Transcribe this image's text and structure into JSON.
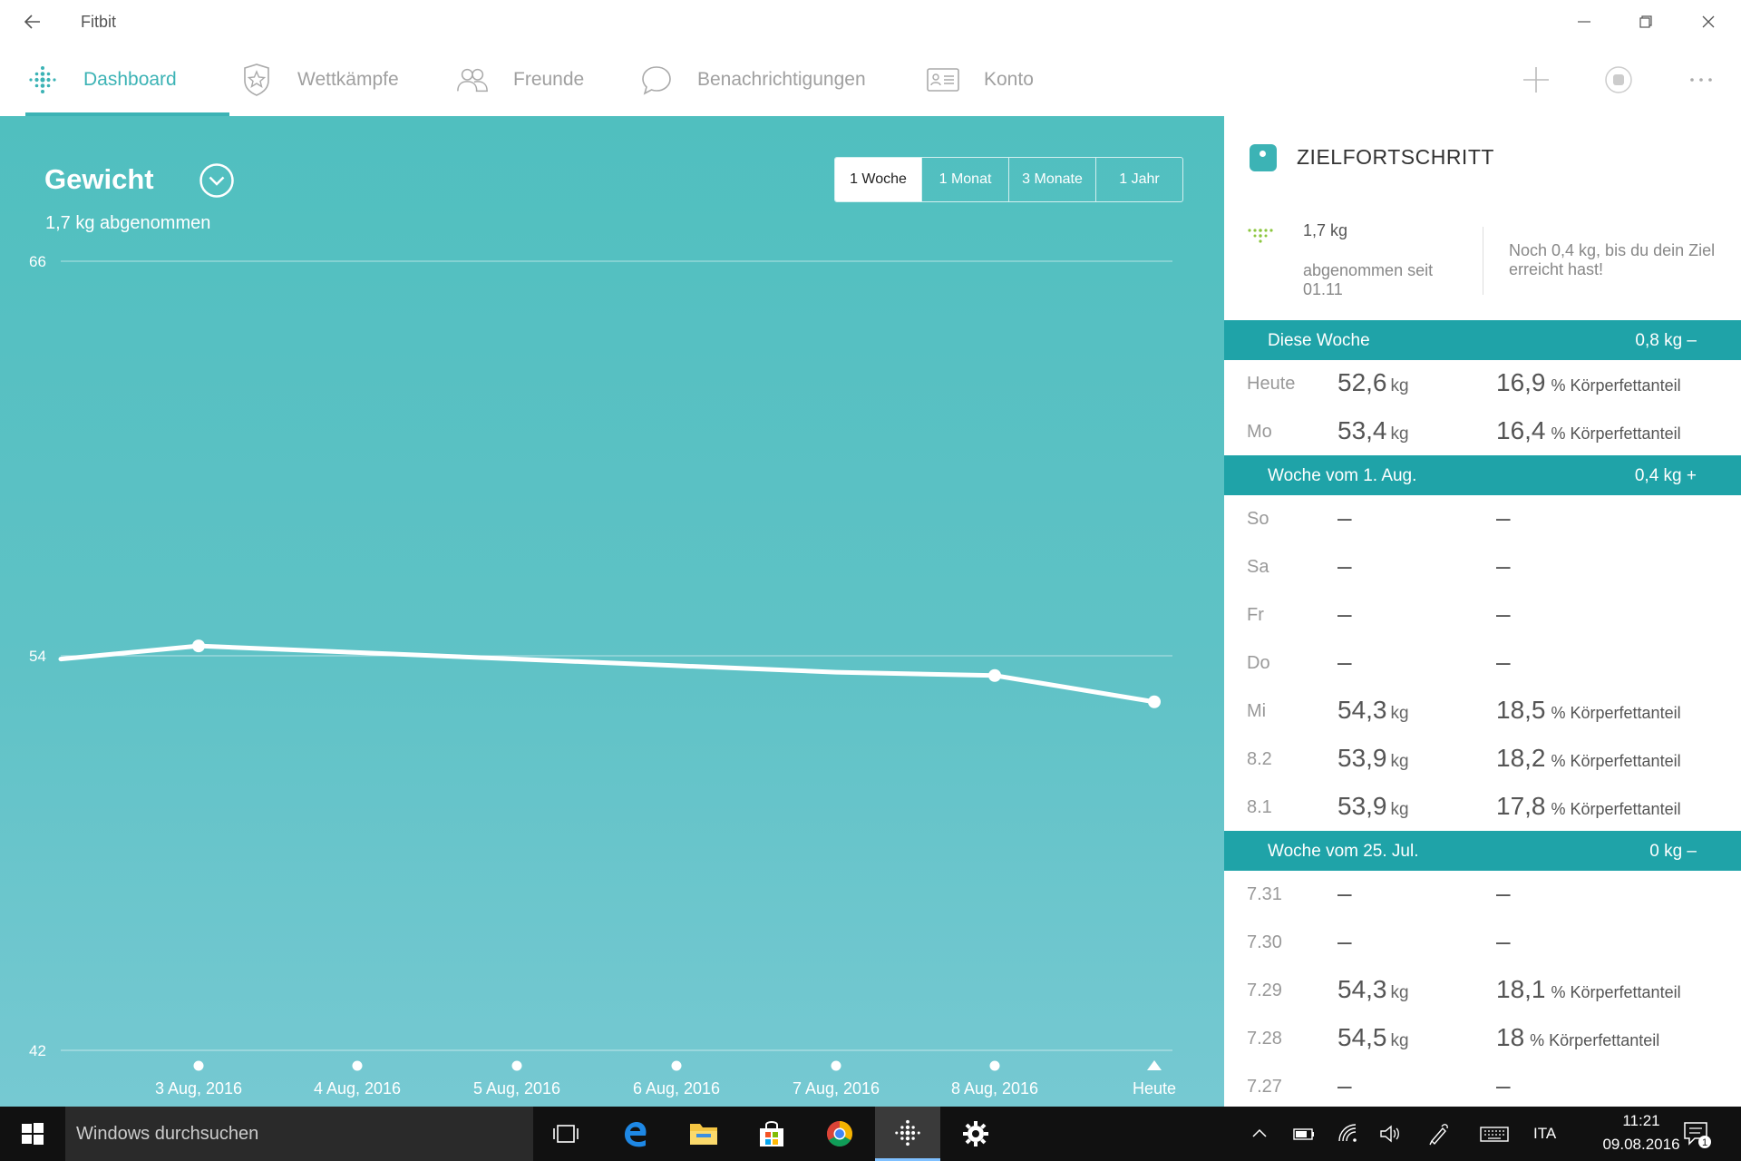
{
  "window": {
    "title": "Fitbit"
  },
  "nav": {
    "items": [
      {
        "label": "Dashboard",
        "icon": "fitbit-dots-icon",
        "active": true
      },
      {
        "label": "Wettkämpfe",
        "icon": "challenge-star-icon",
        "active": false
      },
      {
        "label": "Freunde",
        "icon": "friends-icon",
        "active": false
      },
      {
        "label": "Benachrichtigungen",
        "icon": "chat-bubble-icon",
        "active": false
      },
      {
        "label": "Konto",
        "icon": "account-card-icon",
        "active": false
      }
    ],
    "right_icons": [
      "plus-icon",
      "sync-icon",
      "more-icon"
    ]
  },
  "chart": {
    "title": "Gewicht",
    "subtitle": "1,7 kg abgenommen",
    "ranges": [
      "1 Woche",
      "1 Monat",
      "3 Monate",
      "1 Jahr"
    ],
    "selected_range": "1 Woche"
  },
  "chart_data": {
    "type": "line",
    "title": "Gewicht",
    "ylim": [
      42,
      66
    ],
    "yticks": [
      66,
      54,
      42
    ],
    "grid": true,
    "categories": [
      "3 Aug, 2016",
      "4 Aug, 2016",
      "5 Aug, 2016",
      "6 Aug, 2016",
      "7 Aug, 2016",
      "8 Aug, 2016",
      "Heute"
    ],
    "series": [
      {
        "values": [
          54.3,
          54.1,
          53.9,
          53.7,
          53.5,
          53.4,
          52.6
        ],
        "markers": [
          true,
          false,
          false,
          false,
          false,
          true,
          true
        ]
      }
    ],
    "left_edge_value": 53.9
  },
  "goal": {
    "title": "ZIELFORTSCHRITT",
    "lost": "1,7 kg",
    "since": "abgenommen seit 01.11",
    "remaining": "Noch 0,4 kg, bis du dein Ziel erreicht hast!"
  },
  "weeks": [
    {
      "label": "Diese Woche",
      "delta": "0,8 kg –",
      "rows": [
        {
          "day": "Heute",
          "weight": "52,6",
          "w_unit": "kg",
          "fat": "16,9",
          "f_unit": "% Körperfettanteil"
        },
        {
          "day": "Mo",
          "weight": "53,4",
          "w_unit": "kg",
          "fat": "16,4",
          "f_unit": "% Körperfettanteil"
        }
      ]
    },
    {
      "label": "Woche vom 1. Aug.",
      "delta": "0,4 kg +",
      "rows": [
        {
          "day": "So",
          "weight": "–",
          "w_unit": "",
          "fat": "–",
          "f_unit": ""
        },
        {
          "day": "Sa",
          "weight": "–",
          "w_unit": "",
          "fat": "–",
          "f_unit": ""
        },
        {
          "day": "Fr",
          "weight": "–",
          "w_unit": "",
          "fat": "–",
          "f_unit": ""
        },
        {
          "day": "Do",
          "weight": "–",
          "w_unit": "",
          "fat": "–",
          "f_unit": ""
        },
        {
          "day": "Mi",
          "weight": "54,3",
          "w_unit": "kg",
          "fat": "18,5",
          "f_unit": "% Körperfettanteil"
        },
        {
          "day": "8.2",
          "weight": "53,9",
          "w_unit": "kg",
          "fat": "18,2",
          "f_unit": "% Körperfettanteil"
        },
        {
          "day": "8.1",
          "weight": "53,9",
          "w_unit": "kg",
          "fat": "17,8",
          "f_unit": "% Körperfettanteil"
        }
      ]
    },
    {
      "label": "Woche vom 25. Jul.",
      "delta": "0 kg –",
      "rows": [
        {
          "day": "7.31",
          "weight": "–",
          "w_unit": "",
          "fat": "–",
          "f_unit": ""
        },
        {
          "day": "7.30",
          "weight": "–",
          "w_unit": "",
          "fat": "–",
          "f_unit": ""
        },
        {
          "day": "7.29",
          "weight": "54,3",
          "w_unit": "kg",
          "fat": "18,1",
          "f_unit": "% Körperfettanteil"
        },
        {
          "day": "7.28",
          "weight": "54,5",
          "w_unit": "kg",
          "fat": "18",
          "f_unit": "% Körperfettanteil"
        },
        {
          "day": "7.27",
          "weight": "–",
          "w_unit": "",
          "fat": "–",
          "f_unit": ""
        }
      ]
    }
  ],
  "taskbar": {
    "search_placeholder": "Windows durchsuchen",
    "apps": [
      "task-view-icon",
      "edge-icon",
      "file-explorer-icon",
      "store-icon",
      "chrome-icon",
      "fitbit-icon",
      "settings-icon"
    ],
    "active_app": "fitbit-icon",
    "language": "ITA",
    "time": "11:21",
    "date": "09.08.2016",
    "notification_count": "1"
  },
  "colors": {
    "accent": "#3cb3b5",
    "header_band": "#1fa3a8",
    "chart_bg": "#55c0c2"
  }
}
